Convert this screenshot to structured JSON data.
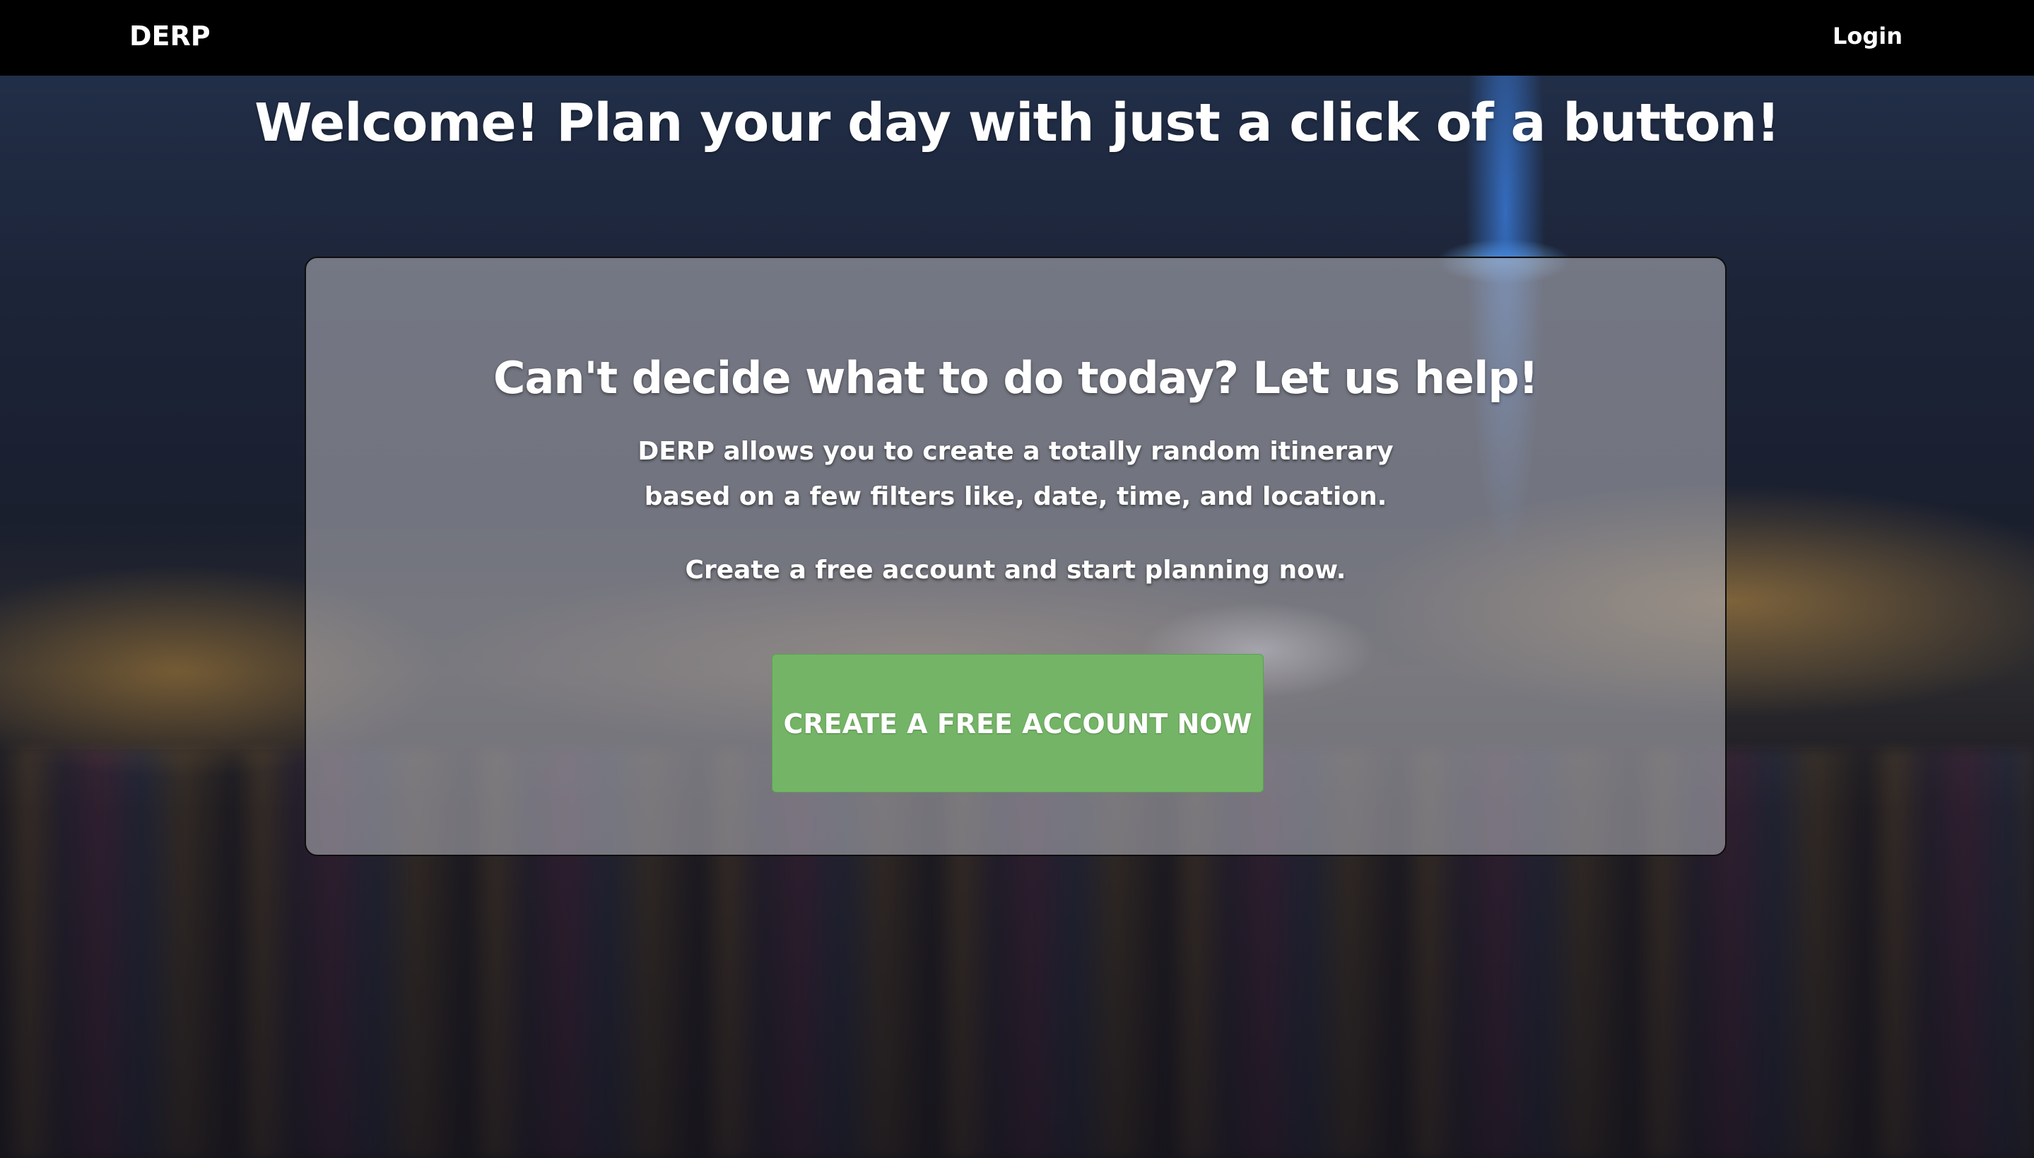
{
  "navbar": {
    "brand": "DERP",
    "login_label": "Login"
  },
  "hero": {
    "title": "Welcome! Plan your day with just a click of a button!"
  },
  "card": {
    "heading": "Can't decide what to do today? Let us help!",
    "description_line1": "DERP allows you to create a totally random itinerary",
    "description_line2": "based on a few filters like, date, time, and location.",
    "cta_text": "Create a free account and start planning now.",
    "button_label": "CREATE A FREE ACCOUNT NOW"
  },
  "colors": {
    "navbar_bg": "#000000",
    "button_bg": "#74b466",
    "card_bg": "rgba(170,170,178,0.62)",
    "text": "#ffffff"
  }
}
